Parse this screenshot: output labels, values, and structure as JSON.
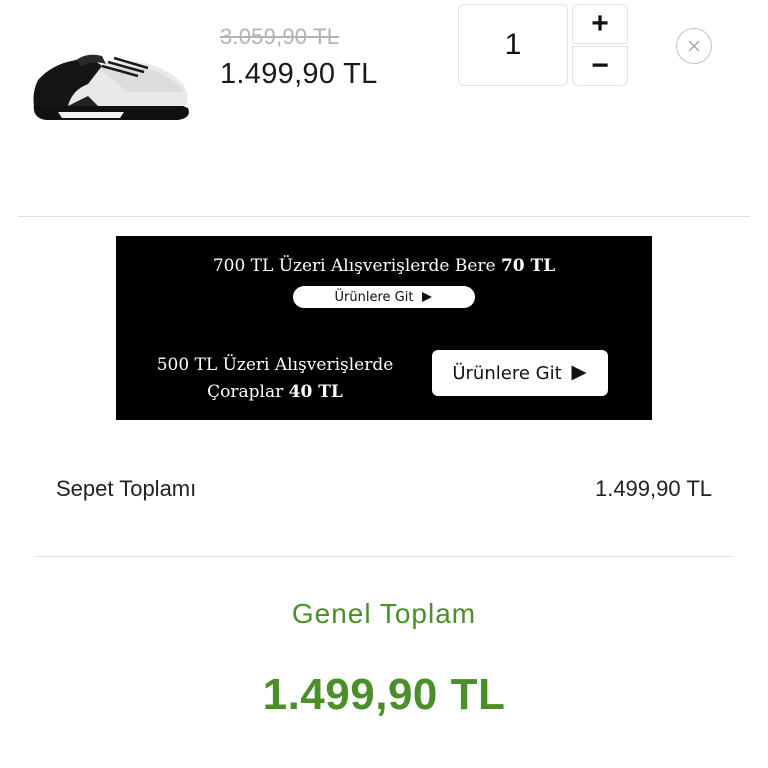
{
  "cart_item": {
    "old_price": "3.059,90 TL",
    "price": "1.499,90 TL",
    "quantity": "1",
    "increment_symbol": "+",
    "decrement_symbol": "−",
    "product_image_icon": "sneaker-product-image",
    "remove_icon": "close-icon"
  },
  "promo_banner": {
    "offer_1_prefix": "700 TL Üzeri Alışverişlerde Bere ",
    "offer_1_highlight": "70 TL",
    "offer_1_cta": "Ürünlere Git",
    "offer_2_prefix": "500 TL Üzeri Alışverişlerde Çoraplar ",
    "offer_2_highlight": "40 TL",
    "offer_2_cta": "Ürünlere Git",
    "cta_icon": "play-arrow-icon"
  },
  "summary": {
    "subtotal_label": "Sepet Toplamı",
    "subtotal_value": "1.499,90 TL",
    "grand_total_label": "Genel Toplam",
    "grand_total_value": "1.499,90 TL"
  },
  "colors": {
    "accent_green": "#4a8f2a",
    "banner_bg": "#000000",
    "old_price_gray": "#b3b3b3"
  }
}
